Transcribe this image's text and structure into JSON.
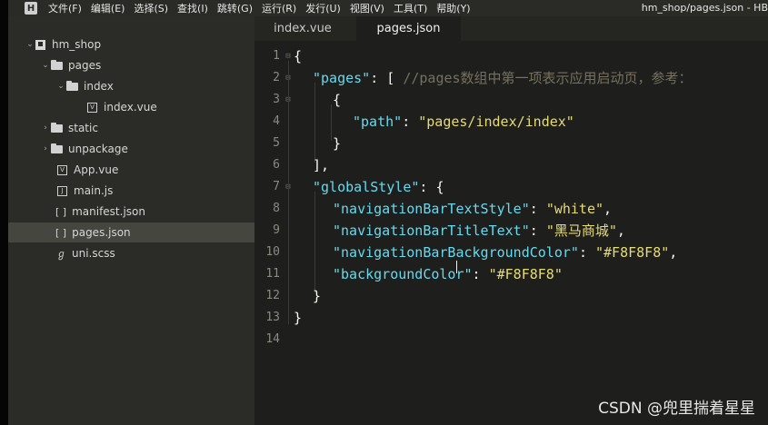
{
  "menubar": {
    "logo": "H",
    "items": [
      "文件(F)",
      "编辑(E)",
      "选择(S)",
      "查找(I)",
      "跳转(G)",
      "运行(R)",
      "发行(U)",
      "视图(V)",
      "工具(T)",
      "帮助(Y)"
    ],
    "title": "hm_shop/pages.json - HB"
  },
  "sidebar": {
    "project": "hm_shop",
    "items": [
      {
        "label": "pages"
      },
      {
        "label": "index"
      },
      {
        "label": "index.vue"
      },
      {
        "label": "static"
      },
      {
        "label": "unpackage"
      },
      {
        "label": "App.vue"
      },
      {
        "label": "main.js"
      },
      {
        "label": "manifest.json"
      },
      {
        "label": "pages.json"
      },
      {
        "label": "uni.scss"
      }
    ]
  },
  "tabs": [
    {
      "label": "index.vue"
    },
    {
      "label": "pages.json"
    }
  ],
  "editor": {
    "line_numbers": [
      "1",
      "2",
      "3",
      "4",
      "5",
      "6",
      "7",
      "8",
      "9",
      "10",
      "11",
      "12",
      "13",
      "14"
    ],
    "tokens": {
      "l1_brace": "{",
      "l2_key": "\"pages\"",
      "l2_punct": ": [ ",
      "l2_comment": "//pages数组中第一项表示应用启动页，参考：",
      "l3_brace": "{",
      "l4_key": "\"path\"",
      "l4_colon": ": ",
      "l4_val": "\"pages/index/index\"",
      "l5_brace": "}",
      "l6_punct": "],",
      "l7_key": "\"globalStyle\"",
      "l7_punct": ": {",
      "l8_key": "\"navigationBarTextStyle\"",
      "l8_colon": ": ",
      "l8_val": "\"white\"",
      "l8_comma": ",",
      "l9_key": "\"navigationBarTitleText\"",
      "l9_colon": ": ",
      "l9_val": "\"黑马商城\"",
      "l9_comma": ",",
      "l10_key": "\"navigationBarBackgroundColor\"",
      "l10_colon": ": ",
      "l10_val": "\"#F8F8F8\"",
      "l10_comma": ",",
      "l11_key": "\"backgroundColor\"",
      "l11_colon": ": ",
      "l11_val": "\"#F8F8F8\"",
      "l12_brace": "}",
      "l13_brace": "}"
    }
  },
  "watermark": "CSDN @兜里揣着星星",
  "colors": {
    "key": "#66d9ef",
    "string": "#e6db74",
    "comment": "#75715e",
    "background": "#1e1f1c"
  }
}
